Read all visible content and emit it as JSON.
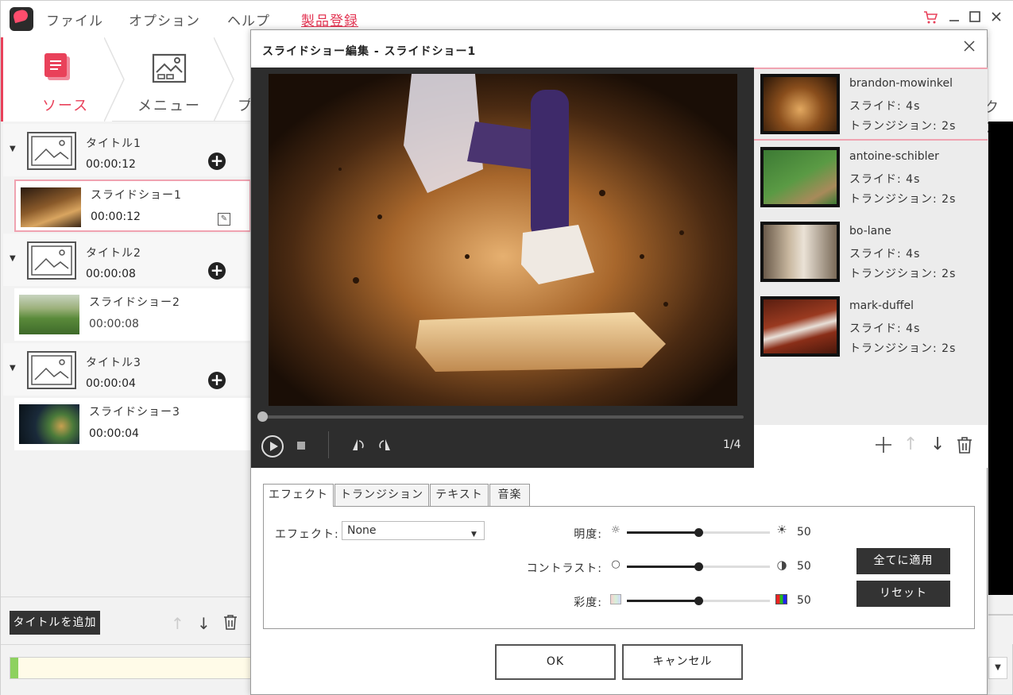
{
  "menu": {
    "file": "ファイル",
    "options": "オプション",
    "help": "ヘルプ",
    "register": "製品登録"
  },
  "steps": {
    "source": "ソース",
    "menu": "メニュー",
    "preview_partial": "プ",
    "right_partial": "クス"
  },
  "titles": [
    {
      "name": "タイトル1",
      "duration": "00:00:12",
      "slideshow": {
        "name": "スライドショー1",
        "duration": "00:00:12"
      }
    },
    {
      "name": "タイトル2",
      "duration": "00:00:08",
      "slideshow": {
        "name": "スライドショー2",
        "duration": "00:00:08"
      }
    },
    {
      "name": "タイトル3",
      "duration": "00:00:04",
      "slideshow": {
        "name": "スライドショー3",
        "duration": "00:00:04"
      }
    }
  ],
  "left_bottom": {
    "add_title": "タイトルを追加"
  },
  "dialog": {
    "title": "スライドショー編集 - スライドショー1",
    "page_counter": "1/4",
    "slides": [
      {
        "name": "brandon-mowinkel",
        "slide": "スライド: 4s",
        "transition": "トランジション: 2s"
      },
      {
        "name": "antoine-schibler",
        "slide": "スライド: 4s",
        "transition": "トランジション: 2s"
      },
      {
        "name": "bo-lane",
        "slide": "スライド: 4s",
        "transition": "トランジション: 2s"
      },
      {
        "name": "mark-duffel",
        "slide": "スライド: 4s",
        "transition": "トランジション: 2s"
      }
    ],
    "tabs": [
      "エフェクト",
      "トランジション",
      "テキスト",
      "音楽"
    ],
    "effect": {
      "label": "エフェクト:",
      "value": "None"
    },
    "adjustments": [
      {
        "label": "明度:",
        "value": "50",
        "level": 0.5
      },
      {
        "label": "コントラスト:",
        "value": "50",
        "level": 0.5
      },
      {
        "label": "彩度:",
        "value": "50",
        "level": 0.5
      }
    ],
    "apply_all": "全てに適用",
    "reset": "リセット",
    "ok": "OK",
    "cancel": "キャンセル"
  },
  "colors": {
    "accent": "#e9415a",
    "dark_button": "#333333",
    "selection_border": "#f0a3b1"
  }
}
